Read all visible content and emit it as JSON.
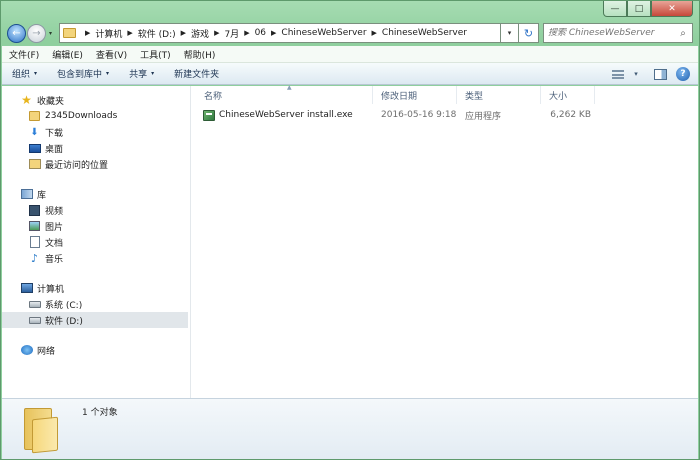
{
  "window": {
    "controls": {
      "minimize": "—",
      "maximize": "□",
      "close": "✕"
    }
  },
  "nav_buttons": {
    "back": "←",
    "forward": "→",
    "history": "▾"
  },
  "address": {
    "crumbs": [
      "计算机",
      "软件 (D:)",
      "游戏",
      "7月",
      "06",
      "ChineseWebServer",
      "ChineseWebServer"
    ],
    "separator": "▶",
    "dropdown": "▾",
    "refresh": "↻"
  },
  "search": {
    "placeholder": "搜索 ChineseWebServer",
    "icon": "⌕"
  },
  "menubar": [
    "文件(F)",
    "编辑(E)",
    "查看(V)",
    "工具(T)",
    "帮助(H)"
  ],
  "commandbar": {
    "organize": "组织",
    "include_library": "包含到库中",
    "share": "共享",
    "new_folder": "新建文件夹",
    "arrow": "▾",
    "help": "?"
  },
  "nav_pane": {
    "favorites": {
      "label": "收藏夹",
      "items": [
        "2345Downloads",
        "下载",
        "桌面",
        "最近访问的位置"
      ]
    },
    "libraries": {
      "label": "库",
      "items": [
        "视频",
        "图片",
        "文档",
        "音乐"
      ]
    },
    "computer": {
      "label": "计算机",
      "items": [
        "系统 (C:)",
        "软件 (D:)"
      ]
    },
    "network": {
      "label": "网络"
    }
  },
  "columns": {
    "name": "名称",
    "date": "修改日期",
    "type": "类型",
    "size": "大小",
    "sort_indicator": "▲"
  },
  "files": [
    {
      "name": "ChineseWebServer install.exe",
      "date": "2016-05-16 9:18",
      "type": "应用程序",
      "size": "6,262 KB"
    }
  ],
  "details": {
    "count": "1 个对象"
  }
}
